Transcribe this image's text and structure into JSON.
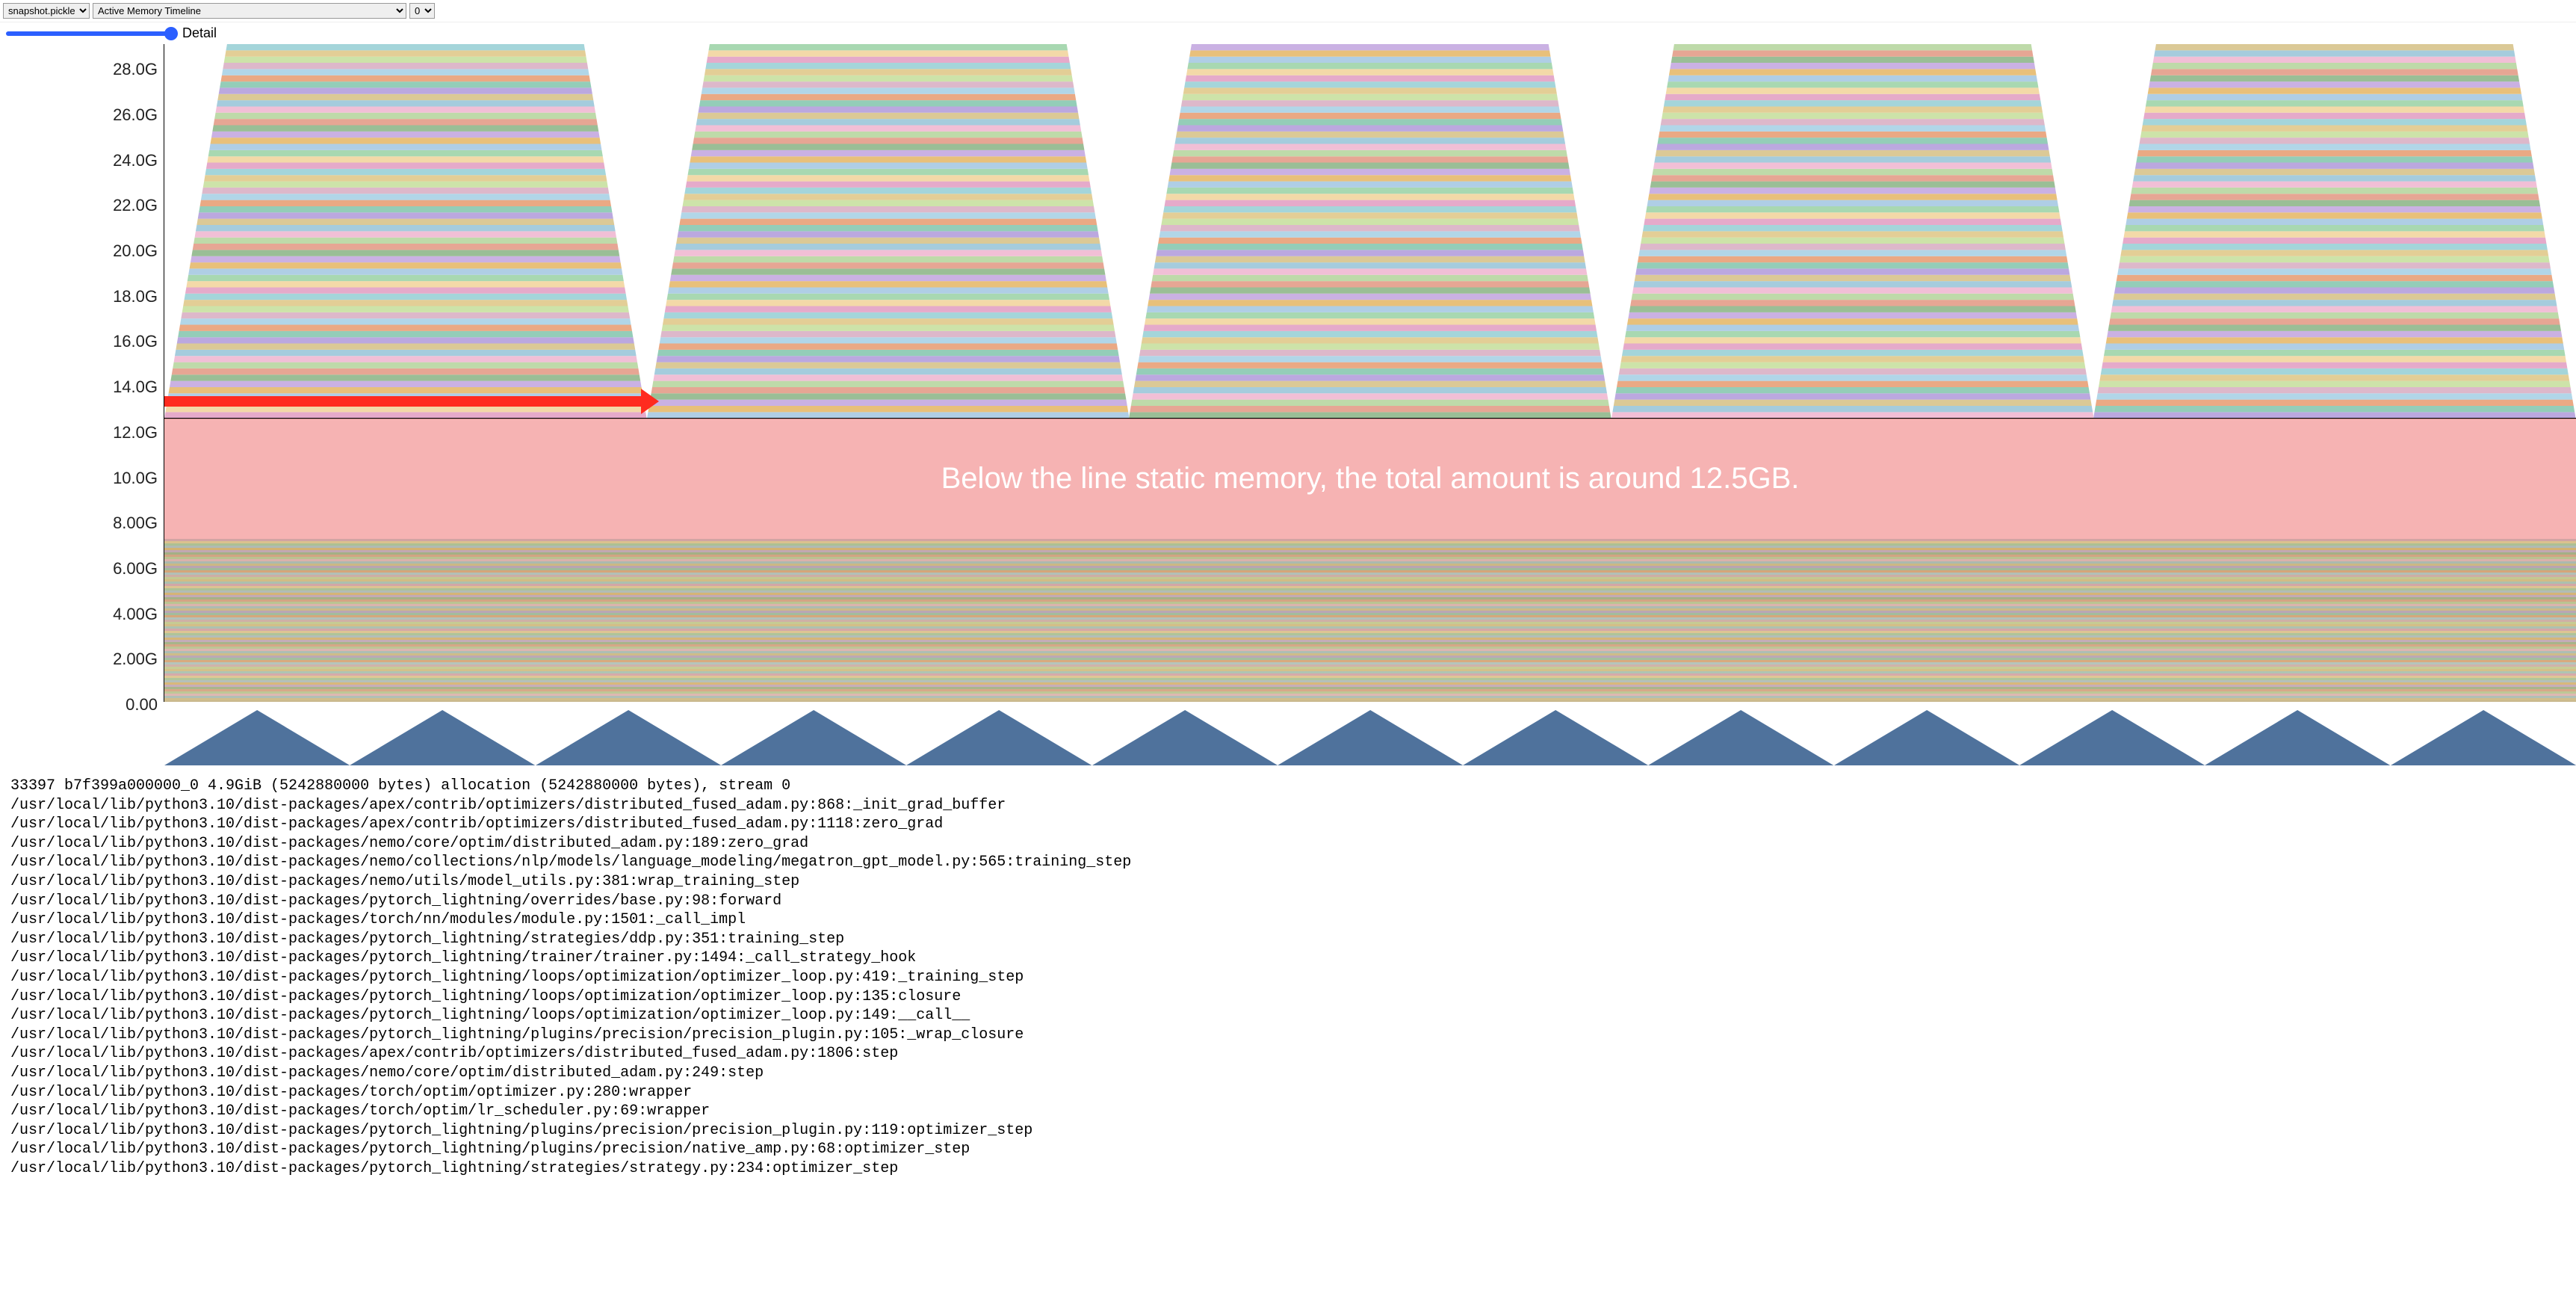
{
  "toolbar": {
    "file_select": "snapshot.pickle",
    "view_select": "Active Memory Timeline",
    "stream_select": "0"
  },
  "slider": {
    "label": "Detail",
    "value": 100,
    "min": 0,
    "max": 100
  },
  "chart_data": {
    "type": "area",
    "xlabel": "",
    "ylabel": "",
    "ylim": [
      0,
      29
    ],
    "y_ticks": [
      "0.00",
      "2.00G",
      "4.00G",
      "6.00G",
      "8.00G",
      "10.0G",
      "12.0G",
      "14.0G",
      "16.0G",
      "18.0G",
      "20.0G",
      "22.0G",
      "24.0G",
      "26.0G",
      "28.0G"
    ],
    "static_memory_gb": 12.5,
    "baseline_gb": 7.2,
    "peak_gb": 28.8,
    "num_cycles": 5,
    "annotation": {
      "text": "Below the line static memory, the total amount is around 12.5GB.",
      "arrow_from_gb": 12.5,
      "band_top_gb": 12.5,
      "band_bottom_gb": 7.2
    },
    "mini_cycles": 13
  },
  "allocation_header": "33397 b7f399a000000_0 4.9GiB (5242880000 bytes) allocation (5242880000 bytes), stream 0",
  "stack_trace": [
    "/usr/local/lib/python3.10/dist-packages/apex/contrib/optimizers/distributed_fused_adam.py:868:_init_grad_buffer",
    "/usr/local/lib/python3.10/dist-packages/apex/contrib/optimizers/distributed_fused_adam.py:1118:zero_grad",
    "/usr/local/lib/python3.10/dist-packages/nemo/core/optim/distributed_adam.py:189:zero_grad",
    "/usr/local/lib/python3.10/dist-packages/nemo/collections/nlp/models/language_modeling/megatron_gpt_model.py:565:training_step",
    "/usr/local/lib/python3.10/dist-packages/nemo/utils/model_utils.py:381:wrap_training_step",
    "/usr/local/lib/python3.10/dist-packages/pytorch_lightning/overrides/base.py:98:forward",
    "/usr/local/lib/python3.10/dist-packages/torch/nn/modules/module.py:1501:_call_impl",
    "/usr/local/lib/python3.10/dist-packages/pytorch_lightning/strategies/ddp.py:351:training_step",
    "/usr/local/lib/python3.10/dist-packages/pytorch_lightning/trainer/trainer.py:1494:_call_strategy_hook",
    "/usr/local/lib/python3.10/dist-packages/pytorch_lightning/loops/optimization/optimizer_loop.py:419:_training_step",
    "/usr/local/lib/python3.10/dist-packages/pytorch_lightning/loops/optimization/optimizer_loop.py:135:closure",
    "/usr/local/lib/python3.10/dist-packages/pytorch_lightning/loops/optimization/optimizer_loop.py:149:__call__",
    "/usr/local/lib/python3.10/dist-packages/pytorch_lightning/plugins/precision/precision_plugin.py:105:_wrap_closure",
    "/usr/local/lib/python3.10/dist-packages/apex/contrib/optimizers/distributed_fused_adam.py:1806:step",
    "/usr/local/lib/python3.10/dist-packages/nemo/core/optim/distributed_adam.py:249:step",
    "/usr/local/lib/python3.10/dist-packages/torch/optim/optimizer.py:280:wrapper",
    "/usr/local/lib/python3.10/dist-packages/torch/optim/lr_scheduler.py:69:wrapper",
    "/usr/local/lib/python3.10/dist-packages/pytorch_lightning/plugins/precision/precision_plugin.py:119:optimizer_step",
    "/usr/local/lib/python3.10/dist-packages/pytorch_lightning/plugins/precision/native_amp.py:68:optimizer_step",
    "/usr/local/lib/python3.10/dist-packages/pytorch_lightning/strategies/strategy.py:234:optimizer_step"
  ],
  "palette": [
    "#e2a1c4",
    "#f2d59e",
    "#9fd4a8",
    "#a6c9e2",
    "#e6b96b",
    "#c4a8e0",
    "#8fb78b",
    "#e39c88",
    "#b7d6a0",
    "#f0b8d2",
    "#9bc7d9",
    "#d7c38b",
    "#b49fdc",
    "#88c8b0",
    "#e8a077",
    "#a8d1e6",
    "#d9b0c4",
    "#c8e0a0",
    "#e0c98b",
    "#9ad0d6"
  ]
}
